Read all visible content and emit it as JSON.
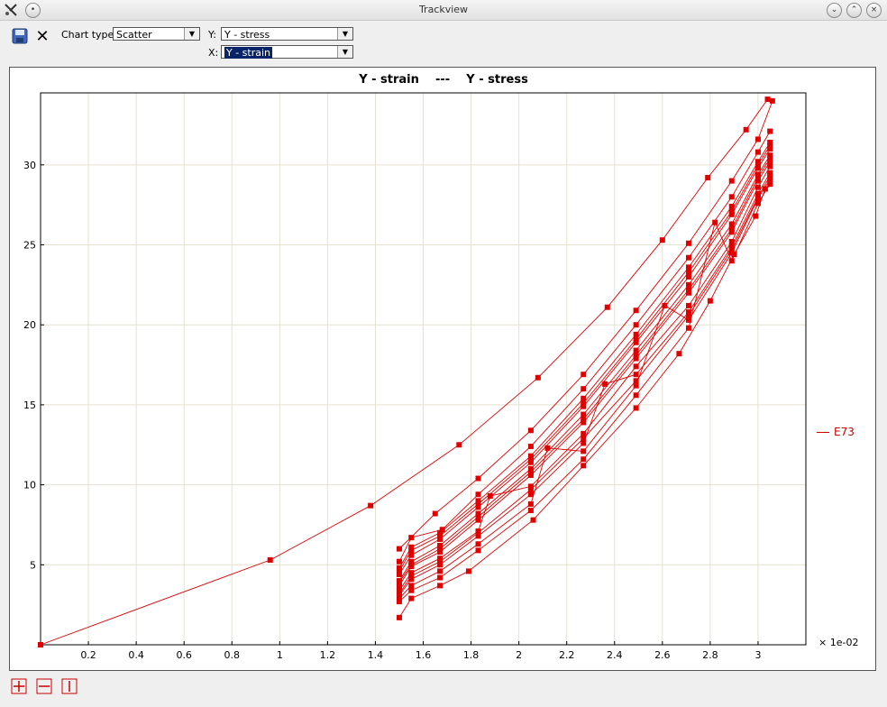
{
  "window": {
    "title": "Trackview"
  },
  "toolbar": {
    "chart_type_label": "Chart type:",
    "chart_type_value": "Scatter",
    "y_label": "Y:",
    "y_value": "Y - stress",
    "x_label": "X:",
    "x_value": "Y - strain"
  },
  "colors": {
    "series": "#e00000",
    "grid": "#e5e1d0"
  },
  "icons": {
    "app": "tools-icon",
    "menu": "menu-icon",
    "save": "save-icon",
    "close": "close-icon",
    "minimize": "minimize-icon",
    "maximize": "maximize-icon",
    "window_close": "window-close-icon",
    "zoom_both": "zoom-both-icon",
    "zoom_x": "zoom-x-icon",
    "zoom_y": "zoom-y-icon"
  },
  "chart_data": {
    "type": "scatter",
    "title": "Y - strain    ---    Y - stress",
    "x_multiplier_label": "× 1e-02",
    "xlim": [
      0,
      3.2
    ],
    "ylim": [
      0,
      34.5
    ],
    "xticks": [
      0.2,
      0.4,
      0.6,
      0.8,
      1,
      1.2,
      1.4,
      1.6,
      1.8,
      2,
      2.2,
      2.4,
      2.6,
      2.8,
      3
    ],
    "xtick_labels": [
      "0.2",
      "0.4",
      "0.6",
      "0.8",
      "1",
      "1.2",
      "1.4",
      "1.6",
      "1.8",
      "2",
      "2.2",
      "2.4",
      "2.6",
      "2.8",
      "3"
    ],
    "yticks": [
      5,
      10,
      15,
      20,
      25,
      30
    ],
    "ytick_labels": [
      "5",
      "10",
      "15",
      "20",
      "25",
      "30"
    ],
    "grid": true,
    "legend": {
      "position": "right",
      "entries": [
        "E73"
      ]
    },
    "series": [
      {
        "name": "E73",
        "points": [
          [
            0,
            0
          ],
          [
            0.96,
            5.3
          ],
          [
            1.38,
            8.7
          ],
          [
            1.75,
            12.5
          ],
          [
            2.08,
            16.7
          ],
          [
            2.37,
            21.1
          ],
          [
            2.6,
            25.3
          ],
          [
            2.79,
            29.2
          ],
          [
            2.95,
            32.2
          ],
          [
            3.04,
            34.1
          ]
        ]
      },
      {
        "points": [
          [
            1.5,
            6.0
          ],
          [
            1.65,
            8.2
          ],
          [
            1.83,
            10.4
          ],
          [
            2.05,
            13.4
          ],
          [
            2.27,
            16.9
          ],
          [
            2.49,
            20.9
          ],
          [
            2.71,
            25.1
          ],
          [
            2.89,
            29.0
          ],
          [
            3.0,
            31.6
          ],
          [
            3.06,
            34.0
          ]
        ]
      },
      {
        "points": [
          [
            1.5,
            5.2
          ],
          [
            1.55,
            6.7
          ],
          [
            1.68,
            7.2
          ],
          [
            1.83,
            9.4
          ],
          [
            2.05,
            12.4
          ],
          [
            2.27,
            16.0
          ],
          [
            2.49,
            20.0
          ],
          [
            2.71,
            24.2
          ],
          [
            2.89,
            28.0
          ],
          [
            3.0,
            30.8
          ],
          [
            3.05,
            32.1
          ]
        ]
      },
      {
        "points": [
          [
            1.5,
            4.8
          ],
          [
            1.55,
            6.1
          ],
          [
            1.67,
            7.0
          ],
          [
            1.83,
            9.0
          ],
          [
            2.05,
            11.8
          ],
          [
            2.27,
            15.4
          ],
          [
            2.49,
            19.4
          ],
          [
            2.71,
            23.6
          ],
          [
            2.89,
            27.4
          ],
          [
            3.0,
            30.2
          ],
          [
            3.05,
            31.4
          ]
        ]
      },
      {
        "points": [
          [
            1.5,
            4.4
          ],
          [
            1.55,
            5.6
          ],
          [
            1.67,
            6.6
          ],
          [
            1.83,
            8.6
          ],
          [
            2.05,
            11.4
          ],
          [
            2.27,
            14.9
          ],
          [
            2.49,
            18.9
          ],
          [
            2.71,
            23.0
          ],
          [
            2.89,
            26.9
          ],
          [
            3.0,
            29.8
          ],
          [
            3.05,
            31.0
          ]
        ]
      },
      {
        "points": [
          [
            1.5,
            4.0
          ],
          [
            1.55,
            5.2
          ],
          [
            1.67,
            6.2
          ],
          [
            1.83,
            8.2
          ],
          [
            2.05,
            11.0
          ],
          [
            2.27,
            14.4
          ],
          [
            2.49,
            18.4
          ],
          [
            2.71,
            22.5
          ],
          [
            2.89,
            26.3
          ],
          [
            3.0,
            29.4
          ],
          [
            3.05,
            30.6
          ]
        ]
      },
      {
        "points": [
          [
            1.5,
            3.7
          ],
          [
            1.55,
            4.9
          ],
          [
            1.67,
            5.8
          ],
          [
            1.83,
            7.8
          ],
          [
            2.05,
            10.6
          ],
          [
            2.27,
            13.9
          ],
          [
            2.49,
            17.9
          ],
          [
            2.71,
            22.0
          ],
          [
            2.89,
            25.8
          ],
          [
            3.0,
            29.0
          ],
          [
            3.05,
            30.2
          ]
        ]
      },
      {
        "points": [
          [
            1.5,
            3.4
          ],
          [
            1.55,
            4.5
          ],
          [
            1.67,
            5.4
          ],
          [
            1.83,
            7.1
          ],
          [
            1.88,
            9.3
          ],
          [
            2.05,
            9.9
          ],
          [
            2.27,
            13.2
          ],
          [
            2.49,
            17.4
          ],
          [
            2.71,
            21.2
          ],
          [
            2.89,
            25.2
          ],
          [
            3.0,
            28.6
          ],
          [
            3.05,
            29.9
          ]
        ]
      },
      {
        "points": [
          [
            1.5,
            3.1
          ],
          [
            1.55,
            4.1
          ],
          [
            1.67,
            5.0
          ],
          [
            1.83,
            6.8
          ],
          [
            2.05,
            9.4
          ],
          [
            2.27,
            12.6
          ],
          [
            2.36,
            16.3
          ],
          [
            2.49,
            16.9
          ],
          [
            2.71,
            20.8
          ],
          [
            2.89,
            24.9
          ],
          [
            3.0,
            28.2
          ],
          [
            3.05,
            29.5
          ]
        ]
      },
      {
        "points": [
          [
            1.5,
            2.9
          ],
          [
            1.55,
            3.7
          ],
          [
            1.67,
            4.6
          ],
          [
            1.83,
            6.3
          ],
          [
            2.05,
            8.8
          ],
          [
            2.12,
            12.3
          ],
          [
            2.27,
            12.1
          ],
          [
            2.49,
            16.2
          ],
          [
            2.61,
            21.2
          ],
          [
            2.71,
            20.3
          ],
          [
            2.89,
            24.5
          ],
          [
            3.0,
            27.9
          ],
          [
            3.05,
            29.1
          ]
        ]
      },
      {
        "points": [
          [
            1.5,
            2.7
          ],
          [
            1.55,
            3.4
          ],
          [
            1.67,
            4.2
          ],
          [
            1.83,
            5.9
          ],
          [
            2.05,
            8.4
          ],
          [
            2.27,
            11.6
          ],
          [
            2.49,
            15.6
          ],
          [
            2.71,
            19.8
          ],
          [
            2.82,
            26.4
          ],
          [
            2.89,
            24.0
          ],
          [
            3.0,
            27.6
          ],
          [
            3.05,
            28.8
          ]
        ]
      },
      {
        "points": [
          [
            1.5,
            1.7
          ],
          [
            1.55,
            2.9
          ],
          [
            1.67,
            3.7
          ],
          [
            1.79,
            4.6
          ],
          [
            2.06,
            7.8
          ],
          [
            2.27,
            11.2
          ],
          [
            2.49,
            14.8
          ],
          [
            2.67,
            18.2
          ],
          [
            2.8,
            21.5
          ],
          [
            2.9,
            24.4
          ],
          [
            2.99,
            26.8
          ],
          [
            3.03,
            28.5
          ]
        ]
      },
      {
        "points": [
          [
            1.5,
            3.2
          ],
          [
            1.55,
            4.3
          ],
          [
            1.67,
            5.2
          ],
          [
            1.83,
            7.0
          ],
          [
            2.05,
            9.7
          ],
          [
            2.27,
            12.9
          ],
          [
            2.49,
            16.5
          ],
          [
            2.71,
            20.6
          ],
          [
            2.89,
            24.7
          ],
          [
            3.0,
            28.0
          ],
          [
            3.05,
            29.3
          ]
        ]
      },
      {
        "points": [
          [
            1.5,
            3.9
          ],
          [
            1.55,
            5.0
          ],
          [
            1.67,
            6.0
          ],
          [
            1.83,
            8.0
          ],
          [
            2.05,
            10.8
          ],
          [
            2.27,
            14.1
          ],
          [
            2.49,
            18.1
          ],
          [
            2.71,
            22.2
          ],
          [
            2.89,
            26.0
          ],
          [
            3.0,
            29.2
          ],
          [
            3.05,
            30.4
          ]
        ]
      },
      {
        "points": [
          [
            1.5,
            4.6
          ],
          [
            1.55,
            5.9
          ],
          [
            1.67,
            6.8
          ],
          [
            1.83,
            8.8
          ],
          [
            2.05,
            11.6
          ],
          [
            2.27,
            15.1
          ],
          [
            2.49,
            19.1
          ],
          [
            2.71,
            23.3
          ],
          [
            2.89,
            27.1
          ],
          [
            3.0,
            30.0
          ],
          [
            3.05,
            31.2
          ]
        ]
      }
    ]
  }
}
